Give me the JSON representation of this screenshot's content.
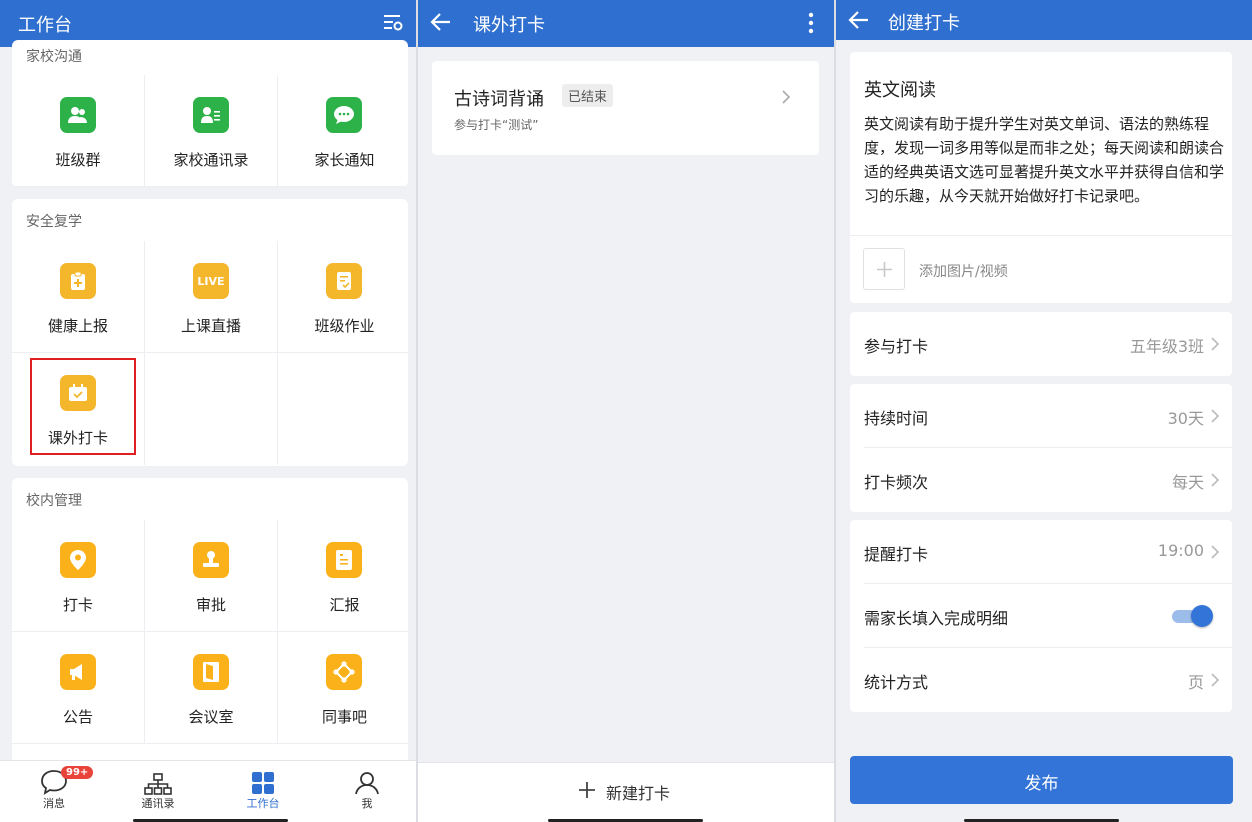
{
  "panel1": {
    "title": "工作台",
    "sections": [
      {
        "title": "家校沟通",
        "items": [
          "班级群",
          "家校通讯录",
          "家长通知"
        ]
      },
      {
        "title": "安全复学",
        "items": [
          "健康上报",
          "上课直播",
          "班级作业",
          "课外打卡"
        ],
        "live_text": "LIVE"
      },
      {
        "title": "校内管理",
        "items": [
          "打卡",
          "审批",
          "汇报",
          "公告",
          "会议室",
          "同事吧"
        ]
      }
    ],
    "tabs": [
      {
        "label": "消息",
        "badge": "99+",
        "icon": "message-icon"
      },
      {
        "label": "通讯录",
        "icon": "contacts-icon"
      },
      {
        "label": "工作台",
        "icon": "workbench-icon",
        "active": true
      },
      {
        "label": "我",
        "icon": "profile-icon"
      }
    ],
    "highlight_color": "#e02020"
  },
  "panel2": {
    "title": "课外打卡",
    "card": {
      "title": "古诗词背诵",
      "status": "已结束",
      "subtitle": "参与打卡“测试”"
    },
    "new_button": "新建打卡"
  },
  "panel3": {
    "title": "创建打卡",
    "heading": "英文阅读",
    "description": "英文阅读有助于提升学生对英文单词、语法的熟练程度，发现一词多用等似是而非之处；每天阅读和朗读合适的经典英语文选可显著提升英文水平并获得自信和学习的乐趣，从今天就开始做好打卡记录吧。",
    "add_media": "添加图片/视频",
    "rows": [
      {
        "label": "参与打卡",
        "value": "五年级3班"
      },
      {
        "label": "持续时间",
        "value": "30天"
      },
      {
        "label": "打卡频次",
        "value": "每天"
      },
      {
        "label": "提醒打卡",
        "value": "19:00"
      },
      {
        "label": "需家长填入完成明细",
        "toggle": true
      },
      {
        "label": "统计方式",
        "value": "页"
      }
    ],
    "publish": "发布"
  },
  "colors": {
    "primary": "#2f6fcf",
    "publish": "#3374d8",
    "green": "#2db24a",
    "yellow": "#f4b62b",
    "badge": "#e8443a"
  }
}
